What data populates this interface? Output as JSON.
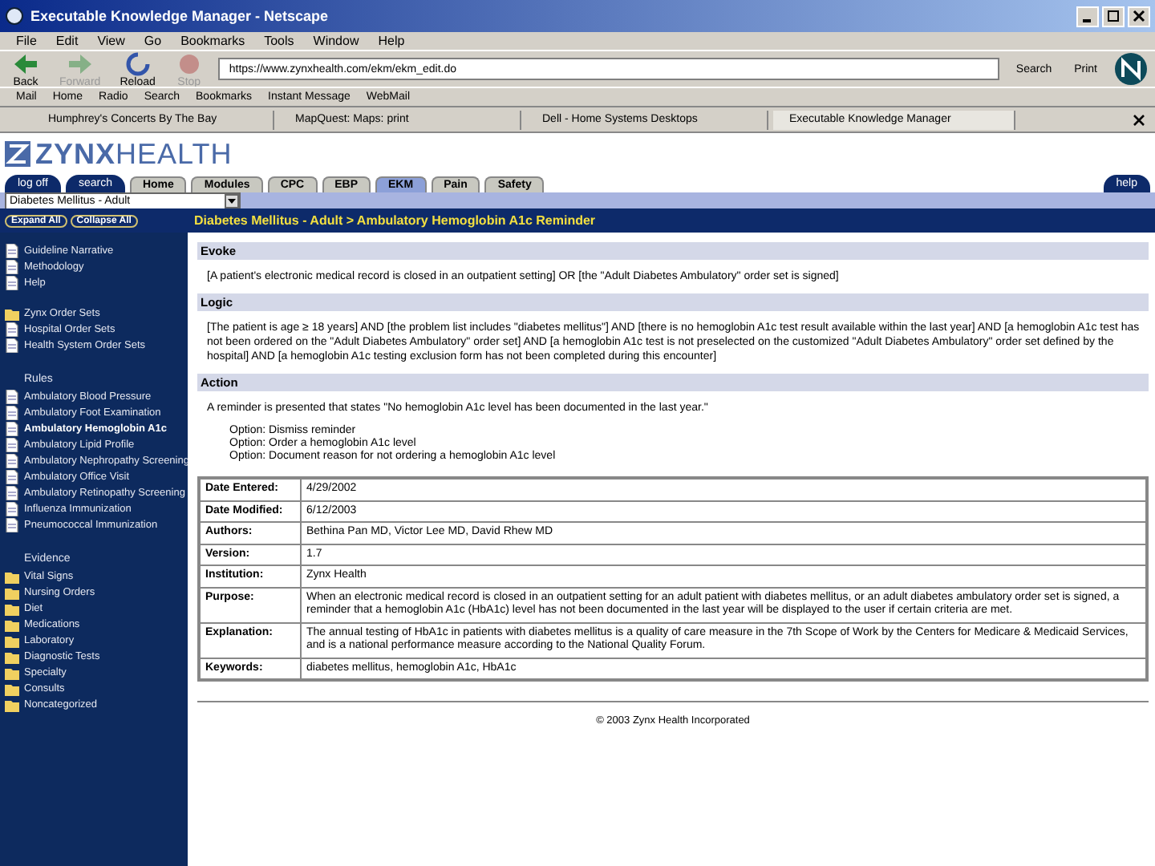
{
  "window": {
    "title": "Executable Knowledge Manager - Netscape"
  },
  "menu": [
    "File",
    "Edit",
    "View",
    "Go",
    "Bookmarks",
    "Tools",
    "Window",
    "Help"
  ],
  "toolbar": {
    "buttons": [
      {
        "label": "Back",
        "disabled": false
      },
      {
        "label": "Forward",
        "disabled": true
      },
      {
        "label": "Reload",
        "disabled": false
      },
      {
        "label": "Stop",
        "disabled": true
      }
    ],
    "url": "https://www.zynxhealth.com/ekm/ekm_edit.do",
    "search": "Search",
    "print": "Print"
  },
  "personal_bar": [
    "Mail",
    "Home",
    "Radio",
    "Search",
    "Bookmarks",
    "Instant Message",
    "WebMail"
  ],
  "browser_tabs": [
    {
      "label": "Humphrey's Concerts By The Bay",
      "selected": false
    },
    {
      "label": "MapQuest: Maps: print",
      "selected": false
    },
    {
      "label": "Dell - Home Systems Desktops",
      "selected": false
    },
    {
      "label": "Executable Knowledge Manager",
      "selected": true
    }
  ],
  "site": {
    "logo_bold": "ZYNX",
    "logo_light": "HEALTH",
    "log_off": "log off",
    "search": "search",
    "help": "help",
    "tabs": [
      {
        "label": "Home",
        "selected": false
      },
      {
        "label": "Modules",
        "selected": false
      },
      {
        "label": "CPC",
        "selected": false
      },
      {
        "label": "EBP",
        "selected": false
      },
      {
        "label": "EKM",
        "selected": true
      },
      {
        "label": "Pain",
        "selected": false
      },
      {
        "label": "Safety",
        "selected": false
      }
    ],
    "module_select": "Diabetes Mellitus - Adult",
    "expand_all": "Expand All",
    "collapse_all": "Collapse All",
    "breadcrumb": "Diabetes Mellitus - Adult > Ambulatory Hemoglobin A1c Reminder"
  },
  "sidebar": {
    "groups": [
      {
        "items": [
          {
            "kind": "doc",
            "label": "Guideline Narrative",
            "selected": false
          },
          {
            "kind": "doc",
            "label": "Methodology",
            "selected": false
          },
          {
            "kind": "doc",
            "label": "Help",
            "selected": false
          }
        ]
      },
      {
        "items": [
          {
            "kind": "folder",
            "label": "Zynx Order Sets",
            "selected": false
          },
          {
            "kind": "doc",
            "label": "Hospital Order Sets",
            "selected": false
          },
          {
            "kind": "doc",
            "label": "Health System Order Sets",
            "selected": false
          }
        ]
      },
      {
        "heading": "Rules",
        "items": [
          {
            "kind": "doc",
            "label": "Ambulatory Blood Pressure",
            "selected": false
          },
          {
            "kind": "doc",
            "label": "Ambulatory Foot Examination",
            "selected": false
          },
          {
            "kind": "doc",
            "label": "Ambulatory Hemoglobin A1c",
            "selected": true
          },
          {
            "kind": "doc",
            "label": "Ambulatory Lipid Profile",
            "selected": false
          },
          {
            "kind": "doc",
            "label": "Ambulatory Nephropathy Screening",
            "selected": false
          },
          {
            "kind": "doc",
            "label": "Ambulatory Office Visit",
            "selected": false
          },
          {
            "kind": "doc",
            "label": "Ambulatory Retinopathy Screening",
            "selected": false
          },
          {
            "kind": "doc",
            "label": "Influenza Immunization",
            "selected": false
          },
          {
            "kind": "doc",
            "label": "Pneumococcal Immunization",
            "selected": false
          }
        ]
      },
      {
        "heading": "Evidence",
        "items": [
          {
            "kind": "folder",
            "label": "Vital Signs",
            "selected": false
          },
          {
            "kind": "folder",
            "label": "Nursing Orders",
            "selected": false
          },
          {
            "kind": "folder",
            "label": "Diet",
            "selected": false
          },
          {
            "kind": "folder",
            "label": "Medications",
            "selected": false
          },
          {
            "kind": "folder",
            "label": "Laboratory",
            "selected": false
          },
          {
            "kind": "folder",
            "label": "Diagnostic Tests",
            "selected": false
          },
          {
            "kind": "folder",
            "label": "Specialty",
            "selected": false
          },
          {
            "kind": "folder",
            "label": "Consults",
            "selected": false
          },
          {
            "kind": "folder",
            "label": "Noncategorized",
            "selected": false
          }
        ]
      }
    ]
  },
  "sections": [
    {
      "title": "Evoke",
      "text": "[A patient's electronic medical record is closed in an outpatient setting] OR [the \"Adult Diabetes Ambulatory\" order set is signed]"
    },
    {
      "title": "Logic",
      "text": "[The patient is age ≥ 18 years] AND [the problem list includes \"diabetes mellitus\"] AND [there is no hemoglobin A1c test result available within the last year] AND [a hemoglobin A1c test has not been ordered on the \"Adult Diabetes Ambulatory\" order set] AND [a hemoglobin A1c test is not preselected on the customized \"Adult Diabetes Ambulatory\" order set defined by the hospital] AND [a hemoglobin A1c testing exclusion form has not been completed during this encounter]"
    },
    {
      "title": "Action",
      "text": "A reminder is presented that states \"No hemoglobin A1c level has been documented in the last year.\"",
      "options": [
        "Option: Dismiss reminder",
        "Option: Order a hemoglobin A1c level",
        "Option: Document reason for not ordering a hemoglobin A1c level"
      ]
    }
  ],
  "details": [
    {
      "label": "Date Entered:",
      "value": "4/29/2002"
    },
    {
      "label": "Date Modified:",
      "value": "6/12/2003"
    },
    {
      "label": "Authors:",
      "value": "Bethina Pan MD, Victor Lee MD, David Rhew MD"
    },
    {
      "label": "Version:",
      "value": "1.7"
    },
    {
      "label": "Institution:",
      "value": "Zynx Health"
    },
    {
      "label": "Purpose:",
      "value": "When an electronic medical record is closed in an outpatient setting for an adult patient with diabetes mellitus, or an adult diabetes ambulatory order set is signed, a reminder that a hemoglobin A1c (HbA1c) level has not been documented in the last year will be displayed to the user if certain criteria are met."
    },
    {
      "label": "Explanation:",
      "value": "The annual testing of HbA1c in patients with diabetes mellitus is a quality of care measure in the 7th Scope of Work by the Centers for Medicare & Medicaid Services, and is a national performance measure according to the National Quality Forum."
    },
    {
      "label": "Keywords:",
      "value": "diabetes mellitus, hemoglobin A1c, HbA1c"
    }
  ],
  "footer": "© 2003 Zynx Health Incorporated"
}
